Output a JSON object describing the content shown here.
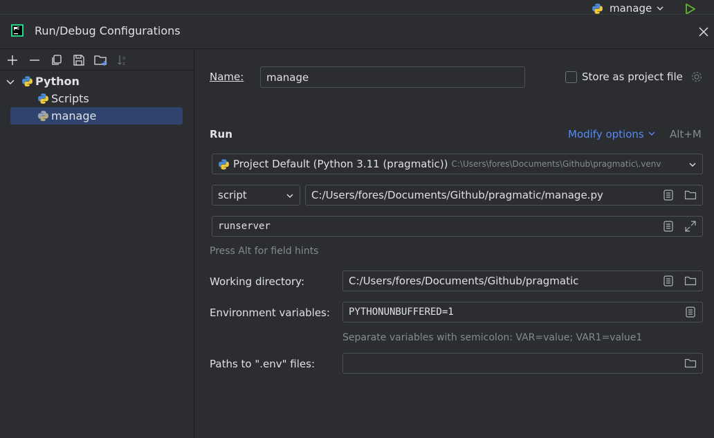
{
  "ide": {
    "run_config_name": "manage"
  },
  "dialog": {
    "title": "Run/Debug Configurations"
  },
  "tree": {
    "root_label": "Python",
    "items": [
      {
        "label": "Scripts"
      },
      {
        "label": "manage"
      }
    ]
  },
  "form": {
    "name_label": "Name:",
    "name_value": "manage",
    "store_label": "Store as project file",
    "run_heading": "Run",
    "modify_options": "Modify options",
    "modify_shortcut": "Alt+M",
    "interpreter_main": "Project Default (Python 3.11 (pragmatic))",
    "interpreter_path": "C:\\Users\\fores\\Documents\\Github\\pragmatic\\.venv",
    "script_type": "script",
    "script_path": "C:/Users/fores/Documents/Github/pragmatic/manage.py",
    "parameters": "runserver",
    "field_hint": "Press Alt for field hints",
    "workdir_label": "Working directory:",
    "workdir_value": "C:/Users/fores/Documents/Github/pragmatic",
    "env_label": "Environment variables:",
    "env_value": "PYTHONUNBUFFERED=1",
    "env_hint": "Separate variables with semicolon: VAR=value; VAR1=value1",
    "dotenv_label": "Paths to \".env\" files:",
    "dotenv_value": ""
  },
  "colors": {
    "accent": "#548af7",
    "selection": "#2e436e",
    "run_green": "#5fb832"
  }
}
